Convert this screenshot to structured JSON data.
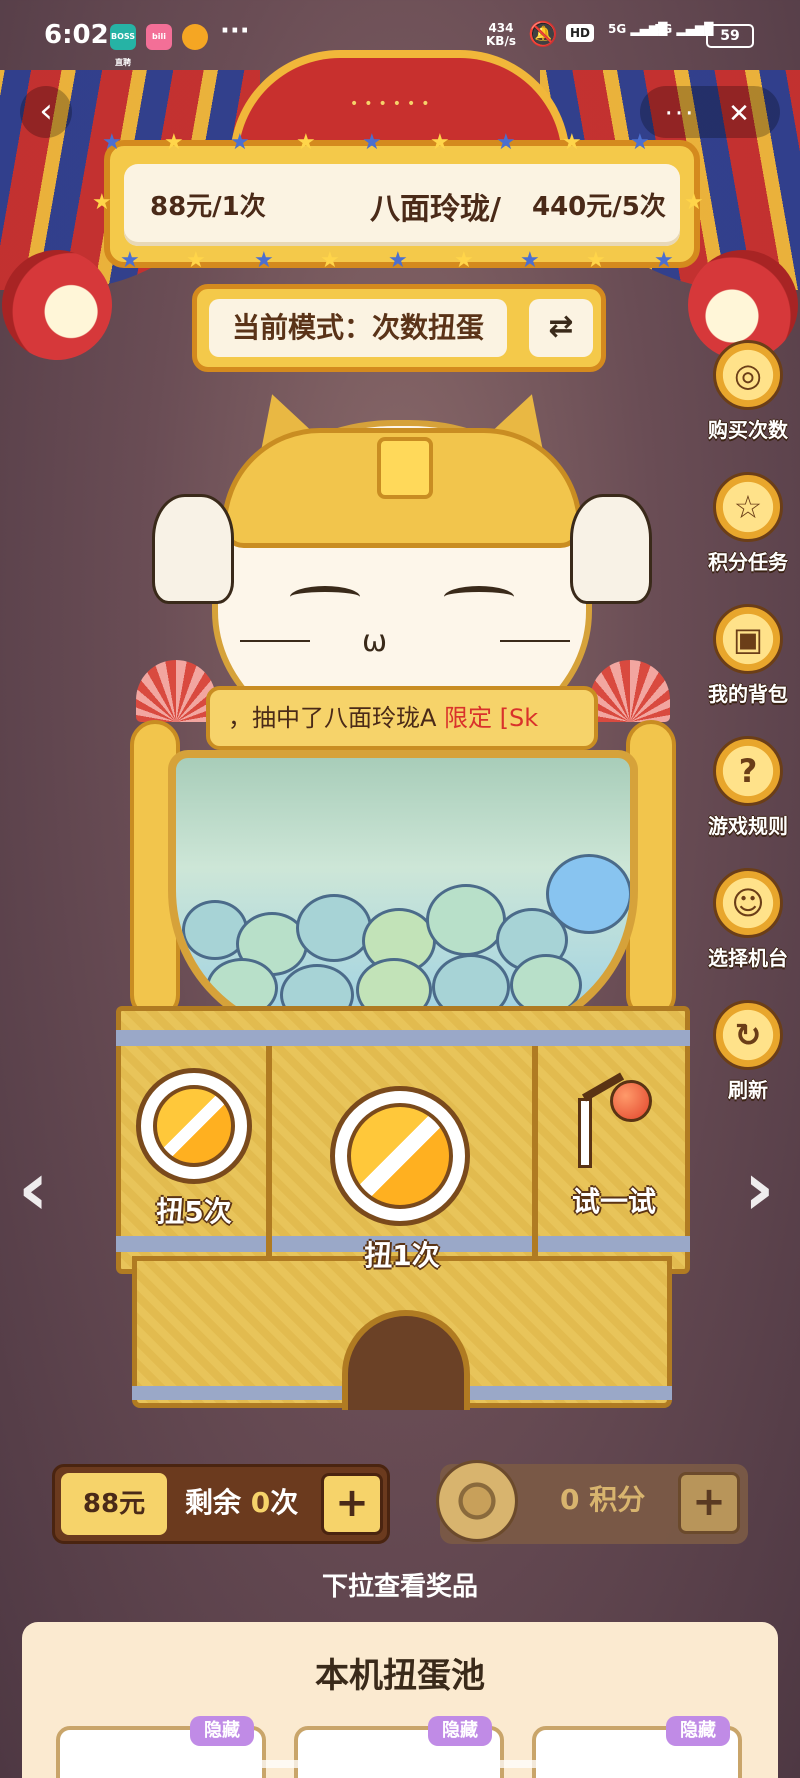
{
  "status_bar": {
    "time": "6:02",
    "app_icons": [
      {
        "name": "boss-zhipin-icon",
        "label": "BOSS直聘",
        "color": "#26b3a5"
      },
      {
        "name": "bilibili-icon",
        "label": "bili",
        "color": "#f36f97"
      },
      {
        "name": "weibo-icon",
        "label": "",
        "color": "#f5a623"
      }
    ],
    "more_dots": "···",
    "net_speed_value": "434",
    "net_speed_unit": "KB/s",
    "hd_label": "HD",
    "signal_1": "5G",
    "signal_2": "5G",
    "battery": "59"
  },
  "nav": {
    "back_icon": "‹",
    "more_icon": "···",
    "close_icon": "✕"
  },
  "price_sign": {
    "single_price": "88元/1次",
    "title": "八面玲珑/",
    "bundle_price": "440元/5次"
  },
  "mode_bar": {
    "label": "当前模式：次数扭蛋",
    "switch_icon": "⇄"
  },
  "side_menu": [
    {
      "label": "购买次数",
      "icon": "coins-icon",
      "glyph": "◎"
    },
    {
      "label": "积分任务",
      "icon": "star-badge-icon",
      "glyph": "☆"
    },
    {
      "label": "我的背包",
      "icon": "bag-icon",
      "glyph": "▣"
    },
    {
      "label": "游戏规则",
      "icon": "question-icon",
      "glyph": "?"
    },
    {
      "label": "选择机台",
      "icon": "machine-icon",
      "glyph": "☺"
    },
    {
      "label": "刷新",
      "icon": "refresh-icon",
      "glyph": "↻"
    }
  ],
  "ticker": {
    "prefix": "，抽中了八面玲珑A ",
    "highlight": "限定 [Sk"
  },
  "machine": {
    "spin5_label": "扭5次",
    "spin1_label": "扭1次",
    "try_label": "试一试"
  },
  "arrows": {
    "prev": "‹",
    "next": "›"
  },
  "wallet": {
    "price": "88元",
    "remain_prefix": "剩余",
    "remain_count": "0",
    "remain_suffix": "次",
    "plus": "+"
  },
  "points": {
    "value": "0",
    "unit": "积分",
    "plus": "+"
  },
  "pull_hint": "下拉查看奖品",
  "prize_pool": {
    "title": "本机扭蛋池",
    "card_tag": "隐藏"
  }
}
